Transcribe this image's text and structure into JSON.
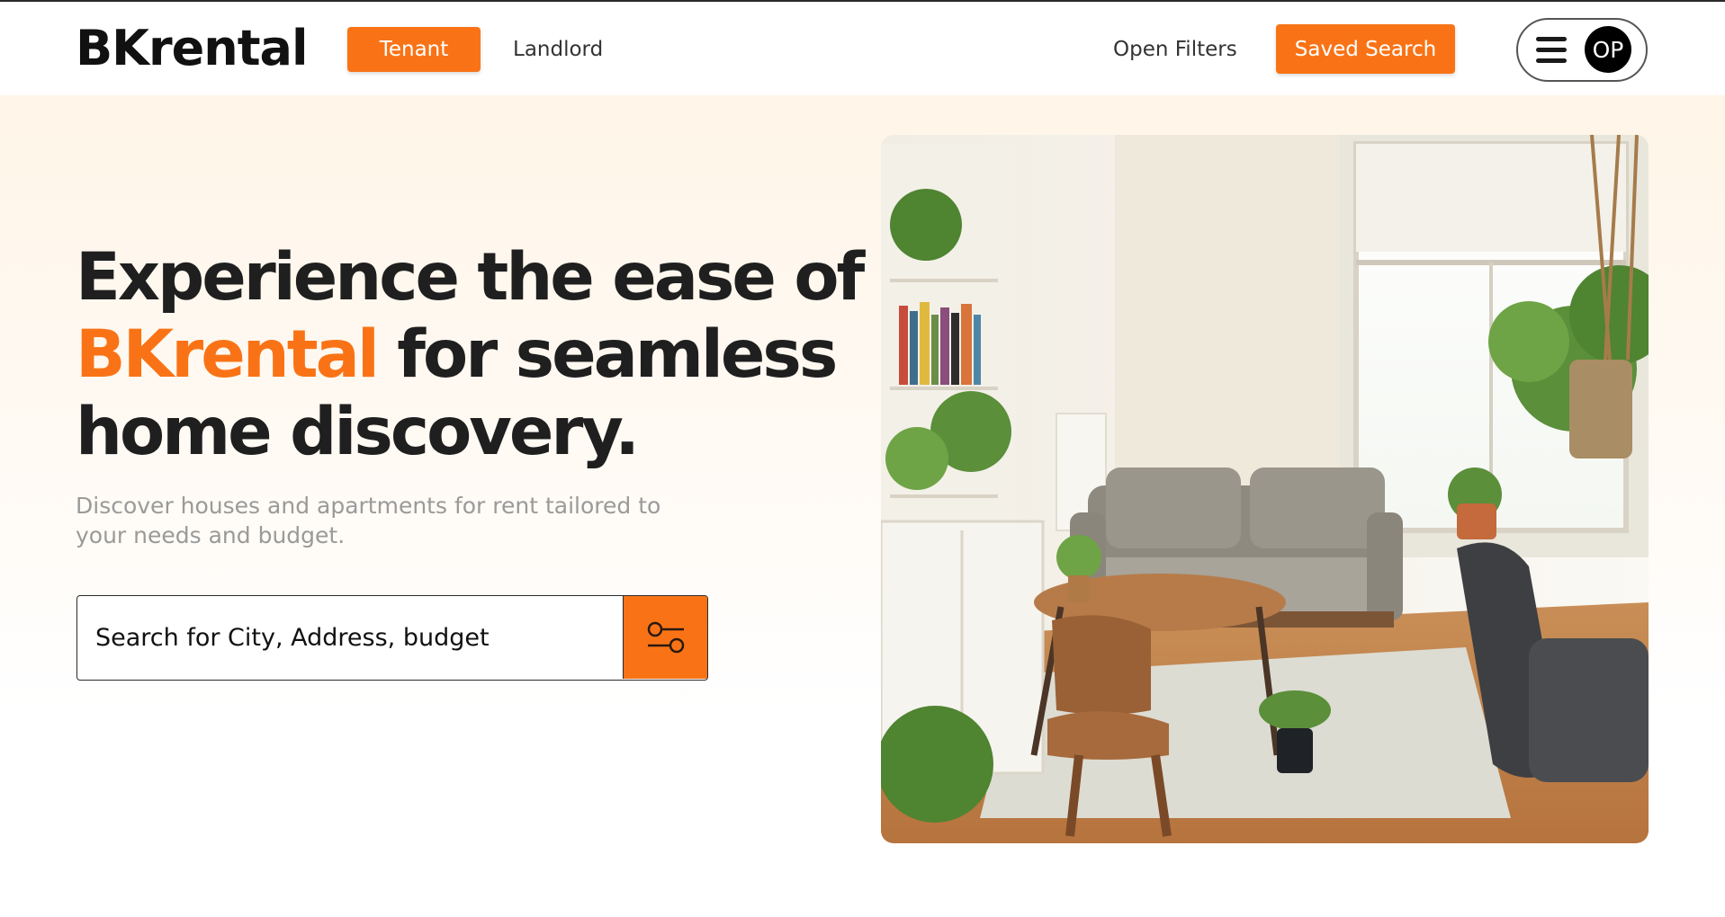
{
  "brand": {
    "name": "BKrental",
    "accent": "#f97316"
  },
  "header": {
    "tenant_label": "Tenant",
    "landlord_label": "Landlord",
    "open_filters_label": "Open Filters",
    "saved_search_label": "Saved Search",
    "avatar_initials": "OP",
    "menu_icon": "hamburger-menu-icon"
  },
  "hero": {
    "headline_part1": "Experience the ease of",
    "headline_accent": "BKrental",
    "headline_part2": " for seamless",
    "headline_part3": "home discovery.",
    "subtext": "Discover houses and apartments for rent tailored to your needs and budget.",
    "search_placeholder": "Search for City, Address, budget",
    "filter_icon": "sliders-filter-icon",
    "image_subject": "living-room-photo"
  }
}
